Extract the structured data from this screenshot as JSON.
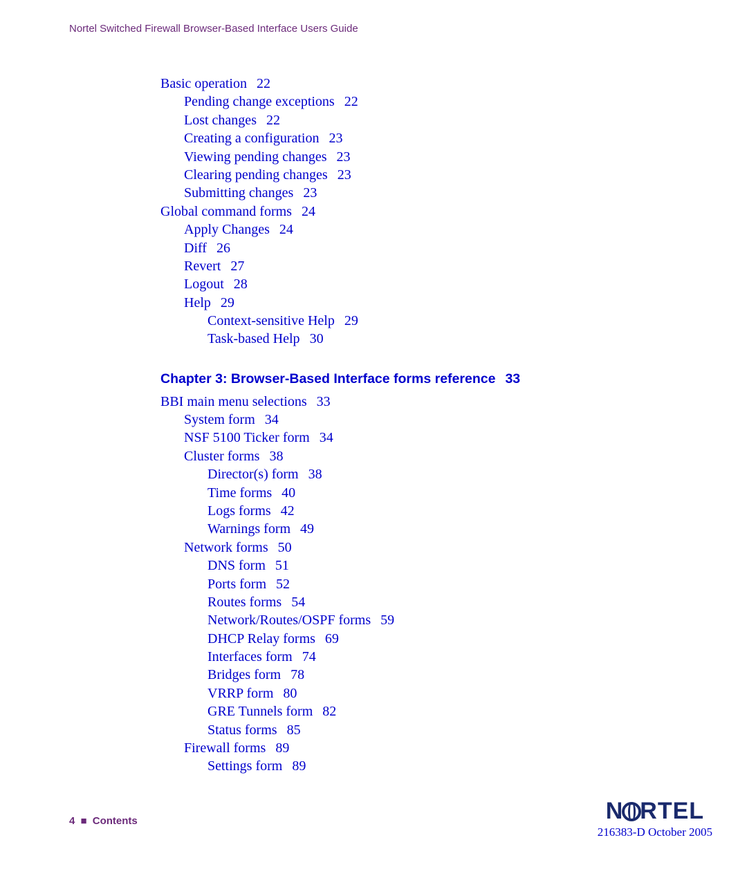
{
  "header": {
    "title": "Nortel Switched Firewall Browser-Based Interface Users Guide"
  },
  "toc": {
    "entries": [
      {
        "level": 0,
        "title": "Basic operation",
        "page": "22"
      },
      {
        "level": 1,
        "title": "Pending change exceptions",
        "page": "22"
      },
      {
        "level": 1,
        "title": "Lost changes",
        "page": "22"
      },
      {
        "level": 1,
        "title": "Creating a configuration",
        "page": "23"
      },
      {
        "level": 1,
        "title": "Viewing pending changes",
        "page": "23"
      },
      {
        "level": 1,
        "title": "Clearing pending changes",
        "page": "23"
      },
      {
        "level": 1,
        "title": "Submitting changes",
        "page": "23"
      },
      {
        "level": 0,
        "title": "Global command forms",
        "page": "24"
      },
      {
        "level": 1,
        "title": "Apply Changes",
        "page": "24"
      },
      {
        "level": 1,
        "title": "Diff",
        "page": "26"
      },
      {
        "level": 1,
        "title": "Revert",
        "page": "27"
      },
      {
        "level": 1,
        "title": "Logout",
        "page": "28"
      },
      {
        "level": 1,
        "title": "Help",
        "page": "29"
      },
      {
        "level": 2,
        "title": "Context-sensitive Help",
        "page": "29"
      },
      {
        "level": 2,
        "title": "Task-based Help",
        "page": "30"
      }
    ],
    "chapter": {
      "title": "Chapter 3: Browser-Based Interface forms reference",
      "page": "33"
    },
    "entries2": [
      {
        "level": 0,
        "title": "BBI main menu selections",
        "page": "33"
      },
      {
        "level": 1,
        "title": "System form",
        "page": "34"
      },
      {
        "level": 1,
        "title": "NSF 5100 Ticker form",
        "page": "34"
      },
      {
        "level": 1,
        "title": "Cluster forms",
        "page": "38"
      },
      {
        "level": 2,
        "title": "Director(s) form",
        "page": "38"
      },
      {
        "level": 2,
        "title": "Time forms",
        "page": "40"
      },
      {
        "level": 2,
        "title": "Logs forms",
        "page": "42"
      },
      {
        "level": 2,
        "title": "Warnings form",
        "page": "49"
      },
      {
        "level": 1,
        "title": "Network forms",
        "page": "50"
      },
      {
        "level": 2,
        "title": "DNS form",
        "page": "51"
      },
      {
        "level": 2,
        "title": "Ports form",
        "page": "52"
      },
      {
        "level": 2,
        "title": "Routes forms",
        "page": "54"
      },
      {
        "level": 2,
        "title": "Network/Routes/OSPF forms",
        "page": "59"
      },
      {
        "level": 2,
        "title": "DHCP Relay forms",
        "page": "69"
      },
      {
        "level": 2,
        "title": "Interfaces form",
        "page": "74"
      },
      {
        "level": 2,
        "title": "Bridges form",
        "page": "78"
      },
      {
        "level": 2,
        "title": "VRRP form",
        "page": "80"
      },
      {
        "level": 2,
        "title": "GRE Tunnels form",
        "page": "82"
      },
      {
        "level": 2,
        "title": "Status forms",
        "page": "85"
      },
      {
        "level": 1,
        "title": "Firewall forms",
        "page": "89"
      },
      {
        "level": 2,
        "title": "Settings form",
        "page": "89"
      }
    ]
  },
  "footer": {
    "page_number": "4",
    "section": "Contents",
    "brand": "NORTEL",
    "docref": "216383-D October 2005"
  }
}
